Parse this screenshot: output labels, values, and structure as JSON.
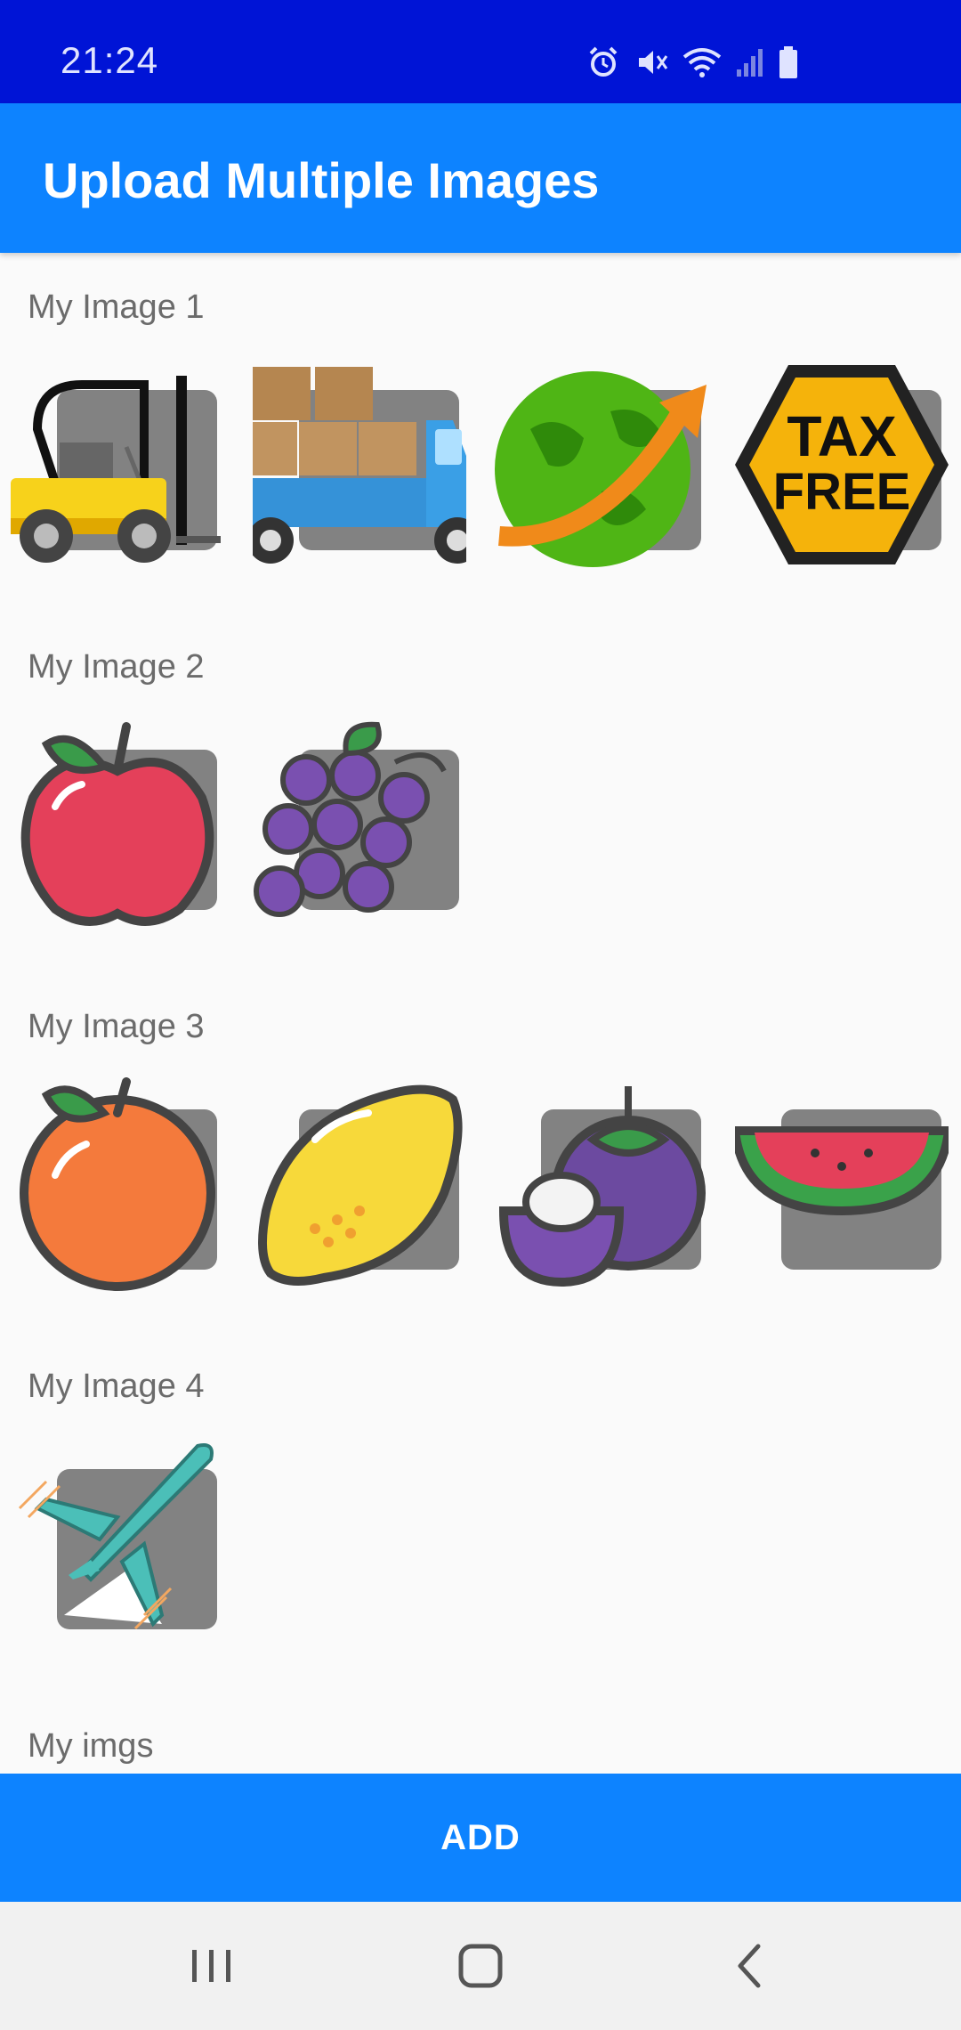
{
  "status_bar": {
    "time": "21:24",
    "icons": [
      "alarm-icon",
      "mute-icon",
      "wifi-icon",
      "signal-icon",
      "battery-icon"
    ],
    "background": "#0014d6"
  },
  "app_bar": {
    "title": "Upload Multiple Images",
    "background": "#0d83ff"
  },
  "sections": [
    {
      "title": "My Image 1",
      "images": [
        "forklift-image",
        "delivery-truck-image",
        "globe-arrow-image",
        "tax-free-badge-image"
      ]
    },
    {
      "title": "My Image 2",
      "images": [
        "apple-image",
        "grapes-image"
      ]
    },
    {
      "title": "My Image 3",
      "images": [
        "orange-image",
        "lemon-image",
        "mangosteen-image",
        "watermelon-image"
      ]
    },
    {
      "title": "My Image 4",
      "images": [
        "airplane-image"
      ]
    },
    {
      "title": "My imgs",
      "images": []
    }
  ],
  "tax_free": {
    "line1": "TAX",
    "line2": "FREE"
  },
  "add_button": {
    "label": "ADD"
  },
  "nav_bar": {
    "recents": "recents-icon",
    "home": "home-icon",
    "back": "back-icon"
  },
  "colors": {
    "accent": "#0d83ff",
    "status": "#0014d6",
    "placeholder": "#828282",
    "section_text": "#6b6b6b"
  }
}
